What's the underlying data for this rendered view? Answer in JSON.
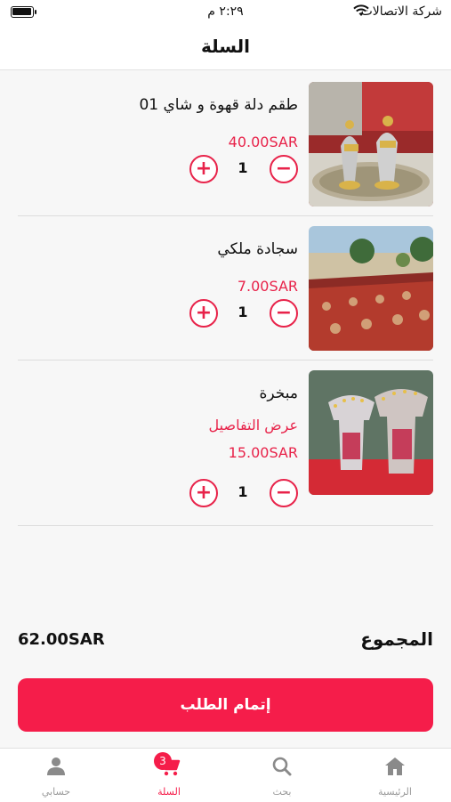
{
  "status_bar": {
    "carrier": "شركة الاتصالات",
    "time": "٢:٢٩ م"
  },
  "header": {
    "title": "السلة"
  },
  "cart": {
    "items": [
      {
        "name": "طقم دلة قهوة و شاي 01",
        "price": "40.00SAR",
        "quantity": "1",
        "image": "coffee-set-image"
      },
      {
        "name": "سجادة ملكي",
        "price": "7.00SAR",
        "quantity": "1",
        "image": "carpet-image"
      },
      {
        "name": "مبخرة",
        "details": "عرض التفاصيل",
        "price": "15.00SAR",
        "quantity": "1",
        "image": "incense-burner-image"
      }
    ],
    "total_label": "المجموع",
    "total_value": "62.00SAR",
    "checkout_label": "إتمام الطلب"
  },
  "tabbar": {
    "home": "الرئيسية",
    "search": "بحث",
    "cart": "السلة",
    "cart_badge": "3",
    "account": "حسابي"
  },
  "colors": {
    "accent": "#f51d4a",
    "price": "#e8234a"
  }
}
